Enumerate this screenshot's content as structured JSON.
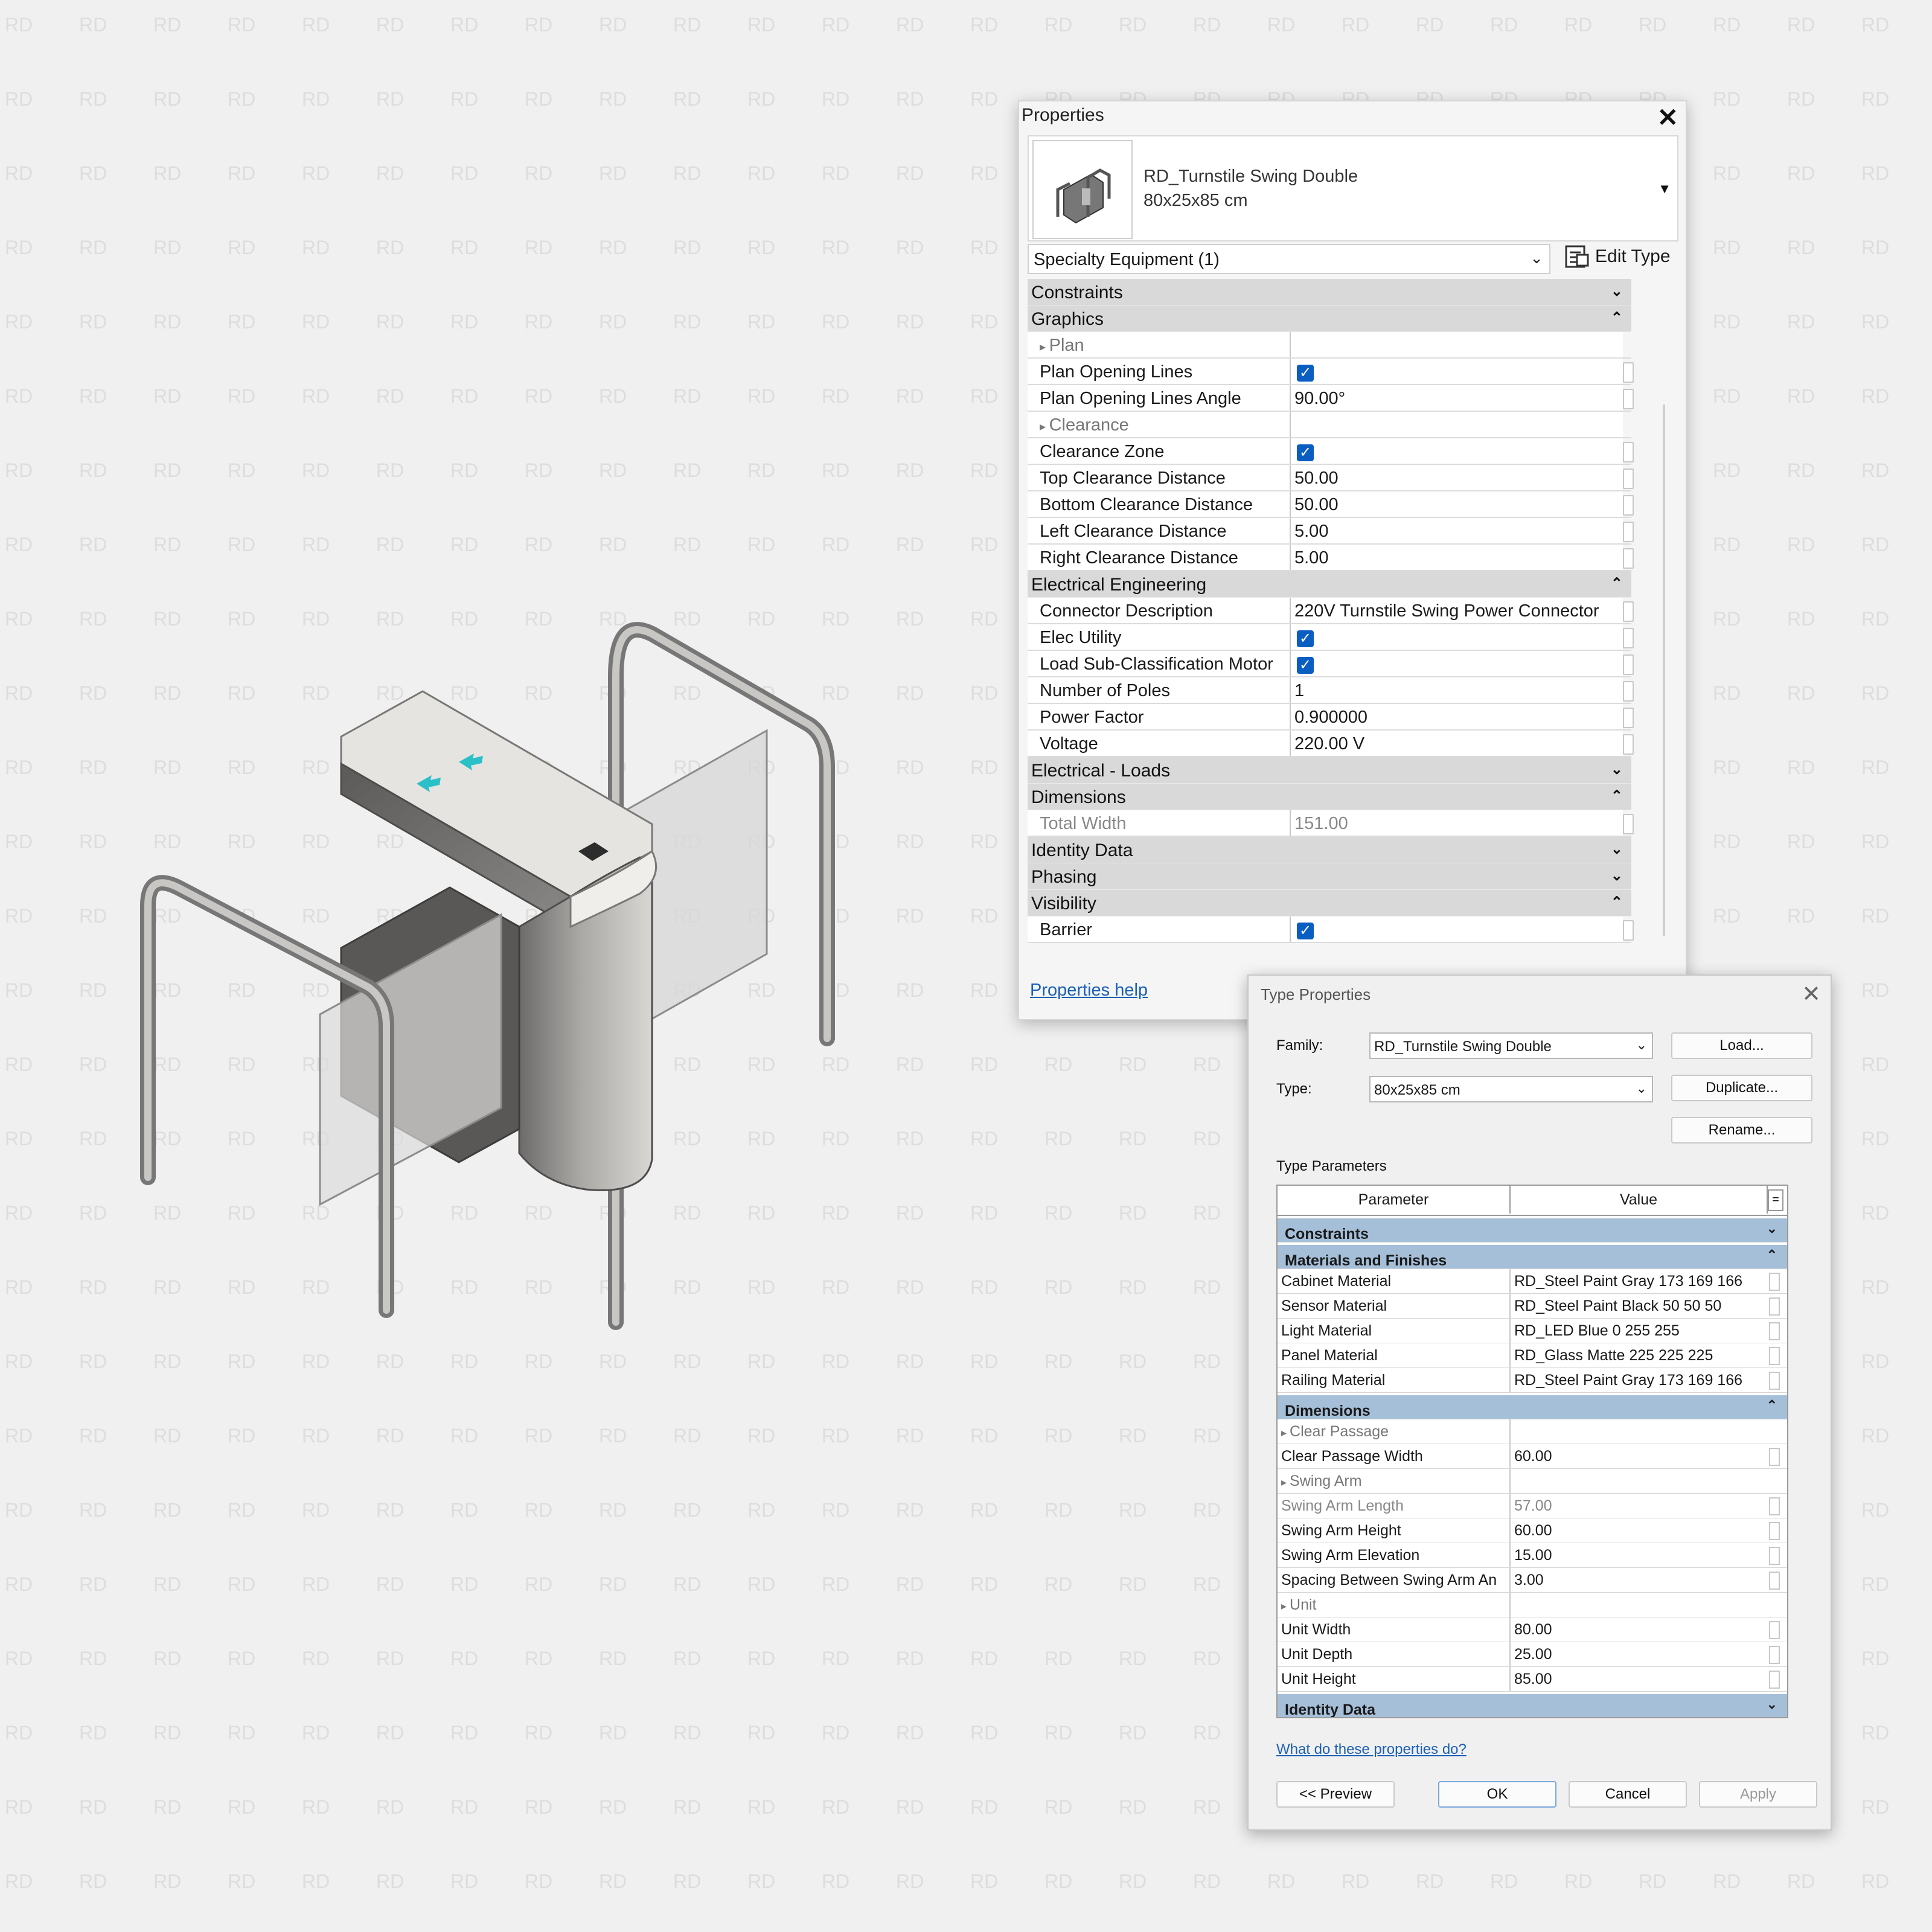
{
  "watermark": "RD",
  "properties": {
    "title": "Properties",
    "close_glyph": "✕",
    "family_name": "RD_Turnstile Swing Double",
    "type_name": "80x25x85 cm",
    "category_filter": "Specialty Equipment (1)",
    "edit_type_label": "Edit Type",
    "help_link": "Properties help",
    "groups": [
      {
        "name": "Constraints",
        "collapsed": true,
        "rows": []
      },
      {
        "name": "Graphics",
        "collapsed": false,
        "rows": [
          {
            "kind": "group",
            "name": "Plan"
          },
          {
            "name": "Plan Opening Lines",
            "checked": true
          },
          {
            "name": "Plan Opening Lines Angle",
            "value": "90.00°"
          },
          {
            "kind": "group",
            "name": "Clearance"
          },
          {
            "name": "Clearance Zone",
            "checked": true
          },
          {
            "name": "Top Clearance Distance",
            "value": "50.00"
          },
          {
            "name": "Bottom Clearance Distance",
            "value": "50.00"
          },
          {
            "name": "Left Clearance Distance",
            "value": "5.00"
          },
          {
            "name": "Right Clearance Distance",
            "value": "5.00"
          }
        ]
      },
      {
        "name": "Electrical Engineering",
        "collapsed": false,
        "rows": [
          {
            "name": "Connector Description",
            "value": "220V Turnstile Swing Power Connector"
          },
          {
            "name": "Elec Utility",
            "checked": true
          },
          {
            "name": "Load Sub-Classification Motor",
            "checked": true
          },
          {
            "name": "Number of Poles",
            "value": "1"
          },
          {
            "name": "Power Factor",
            "value": "0.900000"
          },
          {
            "name": "Voltage",
            "value": "220.00 V"
          }
        ]
      },
      {
        "name": "Electrical - Loads",
        "collapsed": true,
        "rows": []
      },
      {
        "name": "Dimensions",
        "collapsed": false,
        "rows": [
          {
            "name": "Total Width",
            "value": "151.00",
            "readonly": true
          }
        ]
      },
      {
        "name": "Identity Data",
        "collapsed": true,
        "rows": []
      },
      {
        "name": "Phasing",
        "collapsed": true,
        "rows": []
      },
      {
        "name": "Visibility",
        "collapsed": false,
        "rows": [
          {
            "name": "Barrier",
            "checked": true
          }
        ]
      }
    ]
  },
  "type_properties": {
    "title": "Type Properties",
    "close_glyph": "✕",
    "family_label": "Family:",
    "family_value": "RD_Turnstile Swing Double",
    "type_label": "Type:",
    "type_value": "80x25x85 cm",
    "load_button": "Load...",
    "duplicate_button": "Duplicate...",
    "rename_button": "Rename...",
    "section_label": "Type Parameters",
    "col_parameter": "Parameter",
    "col_value": "Value",
    "col_eq": "=",
    "groups": [
      {
        "name": "Constraints",
        "collapsed": true,
        "rows": []
      },
      {
        "name": "Materials and Finishes",
        "collapsed": false,
        "rows": [
          {
            "name": "Cabinet Material",
            "value": "RD_Steel Paint Gray 173 169 166"
          },
          {
            "name": "Sensor Material",
            "value": "RD_Steel Paint Black 50 50 50"
          },
          {
            "name": "Light Material",
            "value": "RD_LED Blue 0 255 255"
          },
          {
            "name": "Panel Material",
            "value": "RD_Glass Matte 225 225 225"
          },
          {
            "name": "Railing Material",
            "value": "RD_Steel Paint Gray 173 169 166"
          }
        ]
      },
      {
        "name": "Dimensions",
        "collapsed": false,
        "rows": [
          {
            "kind": "group",
            "name": "Clear Passage"
          },
          {
            "name": "Clear Passage Width",
            "value": "60.00"
          },
          {
            "kind": "group",
            "name": "Swing Arm"
          },
          {
            "name": "Swing Arm Length",
            "value": "57.00",
            "readonly": true
          },
          {
            "name": "Swing Arm Height",
            "value": "60.00"
          },
          {
            "name": "Swing Arm Elevation",
            "value": "15.00"
          },
          {
            "name": "Spacing Between Swing Arm An",
            "value": "3.00"
          },
          {
            "kind": "group",
            "name": "Unit"
          },
          {
            "name": "Unit Width",
            "value": "80.00"
          },
          {
            "name": "Unit Depth",
            "value": "25.00"
          },
          {
            "name": "Unit Height",
            "value": "85.00"
          }
        ]
      },
      {
        "name": "Identity Data",
        "collapsed": true,
        "rows": []
      }
    ],
    "help_link": "What do these properties do?",
    "preview_button": "<< Preview",
    "ok_button": "OK",
    "cancel_button": "Cancel",
    "apply_button": "Apply"
  },
  "icons": {
    "close": "close-icon",
    "dropdown": "chevron-down-icon",
    "collapse": "double-chevron-up-icon",
    "expand": "double-chevron-down-icon",
    "edit_type": "edit-type-icon",
    "checkbox": "checked-checkbox-icon",
    "light_arrow_color": "#2bbfc8",
    "checkbox_color": "#0a5ec2",
    "type_category_color": "#a5bfd9"
  }
}
